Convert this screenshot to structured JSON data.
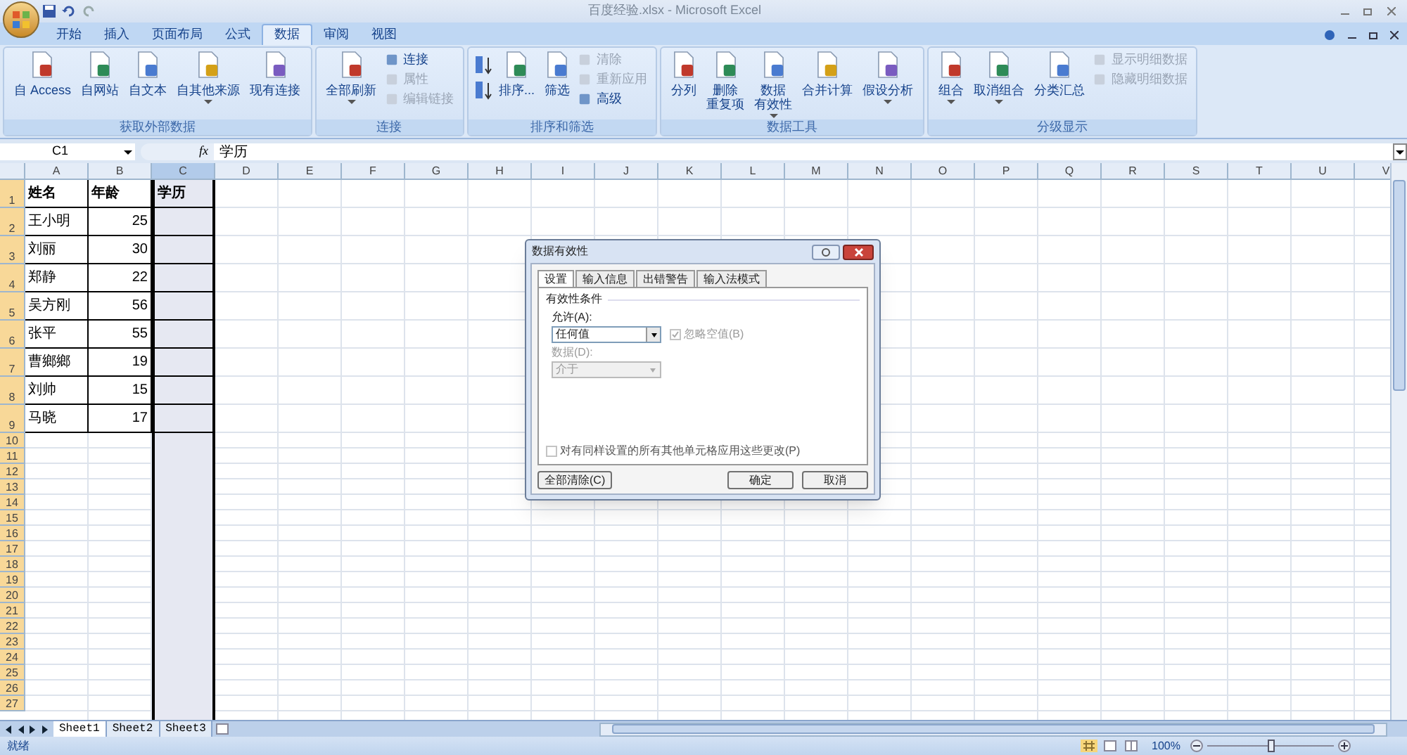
{
  "window": {
    "title": "百度经验.xlsx - Microsoft Excel"
  },
  "tabs": [
    {
      "label": "开始",
      "selected": false
    },
    {
      "label": "插入",
      "selected": false
    },
    {
      "label": "页面布局",
      "selected": false
    },
    {
      "label": "公式",
      "selected": false
    },
    {
      "label": "数据",
      "selected": true
    },
    {
      "label": "审阅",
      "selected": false
    },
    {
      "label": "视图",
      "selected": false
    }
  ],
  "ribbon_groups": [
    {
      "label": "获取外部数据",
      "items": [
        {
          "kind": "large",
          "lines": [
            "自 Access"
          ],
          "disabled": false,
          "dropdown": false
        },
        {
          "kind": "large",
          "lines": [
            "自网站"
          ],
          "disabled": false,
          "dropdown": false
        },
        {
          "kind": "large",
          "lines": [
            "自文本"
          ],
          "disabled": false,
          "dropdown": false
        },
        {
          "kind": "large",
          "lines": [
            "自其他来源"
          ],
          "disabled": false,
          "dropdown": true
        },
        {
          "kind": "large",
          "lines": [
            "现有连接"
          ],
          "disabled": false,
          "dropdown": false
        }
      ]
    },
    {
      "label": "连接",
      "items": [
        {
          "kind": "large",
          "lines": [
            "全部刷新"
          ],
          "disabled": false,
          "dropdown": true
        },
        {
          "kind": "small",
          "lines": [
            "连接"
          ],
          "disabled": false
        },
        {
          "kind": "small",
          "lines": [
            "属性"
          ],
          "disabled": true
        },
        {
          "kind": "small",
          "lines": [
            "编辑链接"
          ],
          "disabled": true
        }
      ]
    },
    {
      "label": "排序和筛选",
      "items": [
        {
          "kind": "sortpair"
        },
        {
          "kind": "large",
          "lines": [
            "排序..."
          ],
          "disabled": false,
          "dropdown": false
        },
        {
          "kind": "large",
          "lines": [
            "筛选"
          ],
          "disabled": false,
          "dropdown": false
        },
        {
          "kind": "small",
          "lines": [
            "清除"
          ],
          "disabled": true
        },
        {
          "kind": "small",
          "lines": [
            "重新应用"
          ],
          "disabled": true
        },
        {
          "kind": "small",
          "lines": [
            "高级"
          ],
          "disabled": false
        }
      ]
    },
    {
      "label": "数据工具",
      "items": [
        {
          "kind": "large",
          "lines": [
            "分列"
          ],
          "disabled": false,
          "dropdown": false
        },
        {
          "kind": "large",
          "lines": [
            "删除",
            "重复项"
          ],
          "disabled": false,
          "dropdown": false
        },
        {
          "kind": "large",
          "lines": [
            "数据",
            "有效性"
          ],
          "disabled": false,
          "dropdown": true
        },
        {
          "kind": "large",
          "lines": [
            "合并计算"
          ],
          "disabled": false,
          "dropdown": false
        },
        {
          "kind": "large",
          "lines": [
            "假设分析"
          ],
          "disabled": false,
          "dropdown": true
        }
      ]
    },
    {
      "label": "分级显示",
      "items": [
        {
          "kind": "large",
          "lines": [
            "组合"
          ],
          "disabled": false,
          "dropdown": true
        },
        {
          "kind": "large",
          "lines": [
            "取消组合"
          ],
          "disabled": false,
          "dropdown": true
        },
        {
          "kind": "large",
          "lines": [
            "分类汇总"
          ],
          "disabled": false,
          "dropdown": false
        },
        {
          "kind": "small",
          "lines": [
            "显示明细数据"
          ],
          "disabled": true
        },
        {
          "kind": "small",
          "lines": [
            "隐藏明细数据"
          ],
          "disabled": true
        }
      ]
    }
  ],
  "formula_bar": {
    "name_box": "C1",
    "fx": "fx",
    "value": "学历"
  },
  "columns": [
    {
      "label": "A",
      "selected": false
    },
    {
      "label": "B",
      "selected": false
    },
    {
      "label": "C",
      "selected": true
    },
    {
      "label": "D",
      "selected": false
    },
    {
      "label": "E",
      "selected": false
    },
    {
      "label": "F",
      "selected": false
    },
    {
      "label": "G",
      "selected": false
    },
    {
      "label": "H",
      "selected": false
    },
    {
      "label": "I",
      "selected": false
    },
    {
      "label": "J",
      "selected": false
    },
    {
      "label": "K",
      "selected": false
    },
    {
      "label": "L",
      "selected": false
    },
    {
      "label": "M",
      "selected": false
    },
    {
      "label": "N",
      "selected": false
    },
    {
      "label": "O",
      "selected": false
    },
    {
      "label": "P",
      "selected": false
    },
    {
      "label": "Q",
      "selected": false
    },
    {
      "label": "R",
      "selected": false
    },
    {
      "label": "S",
      "selected": false
    },
    {
      "label": "T",
      "selected": false
    },
    {
      "label": "U",
      "selected": false
    },
    {
      "label": "V",
      "selected": false
    }
  ],
  "rows": [
    {
      "number": "1",
      "kind": "header",
      "cells": [
        "姓名",
        "年龄",
        "学历"
      ]
    },
    {
      "number": "2",
      "kind": "data",
      "cells": [
        "王小明",
        "25",
        ""
      ]
    },
    {
      "number": "3",
      "kind": "data",
      "cells": [
        "刘丽",
        "30",
        ""
      ]
    },
    {
      "number": "4",
      "kind": "data",
      "cells": [
        "郑静",
        "22",
        ""
      ]
    },
    {
      "number": "5",
      "kind": "data",
      "cells": [
        "吴方刚",
        "56",
        ""
      ]
    },
    {
      "number": "6",
      "kind": "data",
      "cells": [
        "张平",
        "55",
        ""
      ]
    },
    {
      "number": "7",
      "kind": "data",
      "cells": [
        "曹鄉鄉",
        "19",
        ""
      ]
    },
    {
      "number": "8",
      "kind": "data",
      "cells": [
        "刘帅",
        "15",
        ""
      ]
    },
    {
      "number": "9",
      "kind": "data",
      "cells": [
        "马晓",
        "17",
        ""
      ]
    },
    {
      "number": "10",
      "kind": "empty"
    },
    {
      "number": "11",
      "kind": "empty"
    },
    {
      "number": "12",
      "kind": "empty"
    },
    {
      "number": "13",
      "kind": "empty"
    },
    {
      "number": "14",
      "kind": "empty"
    },
    {
      "number": "15",
      "kind": "empty"
    },
    {
      "number": "16",
      "kind": "empty"
    },
    {
      "number": "17",
      "kind": "empty"
    },
    {
      "number": "18",
      "kind": "empty"
    },
    {
      "number": "19",
      "kind": "empty"
    },
    {
      "number": "20",
      "kind": "empty"
    },
    {
      "number": "21",
      "kind": "empty"
    },
    {
      "number": "22",
      "kind": "empty"
    },
    {
      "number": "23",
      "kind": "empty"
    },
    {
      "number": "24",
      "kind": "empty"
    },
    {
      "number": "25",
      "kind": "empty"
    },
    {
      "number": "26",
      "kind": "empty"
    },
    {
      "number": "27",
      "kind": "empty"
    }
  ],
  "sheet_tabs": [
    {
      "label": "Sheet1",
      "selected": true
    },
    {
      "label": "Sheet2",
      "selected": false
    },
    {
      "label": "Sheet3",
      "selected": false
    }
  ],
  "status_bar": {
    "text": "就绪",
    "zoom": "100%",
    "level": 0.5
  },
  "dialog": {
    "title": "数据有效性",
    "tabs": [
      {
        "label": "设置",
        "selected": true
      },
      {
        "label": "输入信息",
        "selected": false
      },
      {
        "label": "出错警告",
        "selected": false
      },
      {
        "label": "输入法模式",
        "selected": false
      }
    ],
    "section": "有效性条件",
    "allow_label": "允许(A):",
    "allow_value": "任何值",
    "ignore_blank": {
      "label": "忽略空值(B)",
      "checked": true,
      "disabled": true
    },
    "data_label": "数据(D):",
    "data_value": "介于",
    "data_disabled": true,
    "apply_all": {
      "label": "对有同样设置的所有其他单元格应用这些更改(P)",
      "checked": false
    },
    "buttons": [
      {
        "label": "全部清除(C)",
        "kind": "left"
      },
      {
        "label": "确定",
        "kind": "default"
      },
      {
        "label": "取消",
        "kind": "normal"
      }
    ]
  }
}
